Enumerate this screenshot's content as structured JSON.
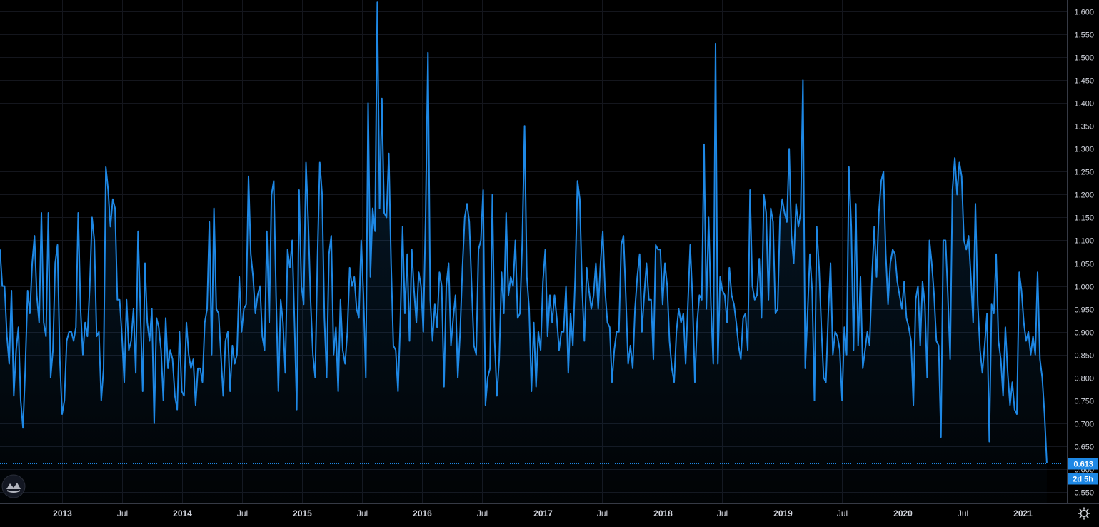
{
  "chart_data": {
    "type": "area",
    "title": "",
    "xlabel": "",
    "ylabel": "",
    "x_ticks": [
      "2013",
      "Jul",
      "2014",
      "Jul",
      "2015",
      "Jul",
      "2016",
      "Jul",
      "2017",
      "Jul",
      "2018",
      "Jul",
      "2019",
      "Jul",
      "2020",
      "Jul",
      "2021"
    ],
    "x_range": [
      "2012-06-25",
      "2021-05-15"
    ],
    "y_ticks": [
      "0.550",
      "0.600",
      "0.650",
      "0.700",
      "0.750",
      "0.800",
      "0.850",
      "0.900",
      "0.950",
      "1.000",
      "1.050",
      "1.100",
      "1.150",
      "1.200",
      "1.250",
      "1.300",
      "1.350",
      "1.400",
      "1.450",
      "1.500",
      "1.550",
      "1.600"
    ],
    "ylim": [
      0.525,
      1.625
    ],
    "series": [
      {
        "color": "#1e88e5",
        "x_start": "2012-06-25",
        "interval": "weekly",
        "values": [
          1.08,
          1.0,
          1.0,
          0.89,
          0.83,
          0.99,
          0.76,
          0.86,
          0.91,
          0.75,
          0.69,
          0.82,
          0.99,
          0.94,
          1.05,
          1.11,
          0.98,
          0.92,
          1.16,
          0.92,
          0.89,
          1.16,
          0.8,
          0.86,
          1.05,
          1.09,
          0.84,
          0.72,
          0.75,
          0.88,
          0.9,
          0.9,
          0.88,
          0.91,
          1.16,
          0.95,
          0.85,
          0.92,
          0.89,
          1.0,
          1.15,
          1.1,
          0.89,
          0.9,
          0.75,
          0.82,
          1.26,
          1.21,
          1.13,
          1.19,
          1.17,
          0.97,
          0.97,
          0.89,
          0.79,
          0.97,
          0.86,
          0.88,
          0.95,
          0.81,
          1.12,
          0.95,
          0.77,
          1.05,
          0.92,
          0.88,
          0.95,
          0.7,
          0.93,
          0.91,
          0.86,
          0.75,
          0.93,
          0.82,
          0.86,
          0.84,
          0.76,
          0.73,
          0.9,
          0.77,
          0.76,
          0.92,
          0.85,
          0.82,
          0.84,
          0.74,
          0.82,
          0.82,
          0.79,
          0.92,
          0.95,
          1.14,
          0.85,
          1.17,
          0.95,
          0.94,
          0.85,
          0.76,
          0.88,
          0.9,
          0.77,
          0.87,
          0.83,
          0.85,
          1.02,
          0.9,
          0.95,
          0.96,
          1.24,
          1.07,
          1.02,
          0.94,
          0.98,
          1.0,
          0.89,
          0.86,
          1.12,
          0.92,
          1.2,
          1.23,
          0.98,
          0.77,
          0.97,
          0.92,
          0.81,
          1.08,
          1.04,
          1.1,
          0.92,
          0.73,
          1.21,
          1.0,
          0.96,
          1.27,
          1.14,
          0.97,
          0.85,
          0.8,
          1.06,
          1.27,
          1.2,
          0.93,
          0.8,
          1.07,
          1.11,
          0.85,
          0.91,
          0.77,
          0.97,
          0.86,
          0.83,
          0.9,
          1.04,
          1.0,
          1.02,
          0.95,
          0.93,
          1.1,
          0.98,
          0.8,
          1.4,
          1.02,
          1.17,
          1.12,
          1.62,
          1.17,
          1.41,
          1.16,
          1.15,
          1.29,
          1.05,
          0.87,
          0.86,
          0.77,
          0.92,
          1.13,
          0.94,
          1.07,
          0.88,
          1.08,
          0.99,
          0.92,
          1.03,
          1.0,
          0.9,
          1.15,
          1.51,
          0.97,
          0.88,
          0.96,
          0.91,
          1.03,
          1.0,
          0.78,
          1.0,
          1.05,
          0.87,
          0.93,
          0.98,
          0.8,
          0.9,
          1.04,
          1.15,
          1.18,
          1.14,
          1.0,
          0.87,
          0.85,
          1.08,
          1.1,
          1.21,
          0.74,
          0.8,
          0.82,
          1.2,
          0.88,
          0.76,
          0.84,
          1.03,
          0.94,
          1.16,
          0.98,
          1.02,
          1.0,
          1.1,
          0.93,
          0.94,
          1.1,
          1.35,
          1.02,
          0.95,
          0.77,
          0.92,
          0.78,
          0.9,
          0.86,
          1.01,
          1.08,
          0.89,
          0.98,
          0.92,
          0.98,
          0.93,
          0.86,
          0.9,
          0.9,
          1.0,
          0.81,
          0.94,
          0.87,
          1.02,
          1.23,
          1.19,
          1.0,
          0.88,
          1.04,
          0.99,
          0.95,
          0.98,
          1.05,
          0.95,
          1.05,
          1.12,
          0.99,
          0.92,
          0.91,
          0.79,
          0.86,
          0.9,
          0.9,
          1.09,
          1.11,
          0.98,
          0.83,
          0.87,
          0.82,
          0.95,
          1.02,
          1.07,
          0.9,
          0.98,
          1.05,
          0.97,
          0.97,
          0.84,
          1.09,
          1.08,
          1.08,
          0.96,
          1.05,
          1.0,
          0.88,
          0.82,
          0.79,
          0.9,
          0.95,
          0.92,
          0.94,
          0.83,
          0.96,
          1.09,
          0.97,
          0.79,
          0.92,
          0.98,
          0.97,
          1.31,
          0.95,
          1.15,
          0.96,
          0.83,
          1.53,
          0.83,
          1.02,
          0.99,
          0.98,
          0.92,
          1.04,
          0.98,
          0.96,
          0.92,
          0.87,
          0.84,
          0.93,
          0.94,
          0.86,
          1.21,
          1.0,
          0.97,
          0.98,
          1.06,
          0.93,
          1.2,
          1.16,
          0.97,
          1.17,
          1.14,
          0.94,
          0.95,
          1.15,
          1.19,
          1.16,
          1.14,
          1.3,
          1.11,
          1.05,
          1.18,
          1.13,
          1.16,
          1.45,
          0.82,
          0.94,
          1.07,
          0.99,
          0.75,
          1.13,
          1.04,
          0.91,
          0.8,
          0.79,
          0.94,
          1.05,
          0.85,
          0.9,
          0.89,
          0.86,
          0.75,
          0.91,
          0.85,
          1.26,
          1.13,
          0.86,
          1.18,
          0.87,
          1.02,
          0.82,
          0.86,
          0.9,
          0.87,
          1.02,
          1.13,
          1.02,
          1.16,
          1.23,
          1.25,
          1.07,
          0.96,
          1.05,
          1.08,
          1.07,
          1.01,
          0.98,
          0.95,
          1.01,
          0.93,
          0.91,
          0.88,
          0.74,
          0.97,
          1.0,
          0.87,
          1.01,
          0.96,
          0.8,
          1.1,
          1.05,
          0.98,
          0.88,
          0.87,
          0.67,
          1.1,
          1.1,
          0.98,
          0.84,
          1.21,
          1.28,
          1.2,
          1.27,
          1.24,
          1.1,
          1.08,
          1.11,
          1.02,
          0.92,
          1.18,
          0.96,
          0.86,
          0.81,
          0.87,
          0.94,
          0.66,
          0.96,
          0.94,
          1.07,
          0.88,
          0.84,
          0.76,
          0.91,
          0.81,
          0.74,
          0.79,
          0.73,
          0.72,
          1.03,
          0.99,
          0.92,
          0.88,
          0.9,
          0.85,
          0.89,
          0.85,
          1.03,
          0.84,
          0.8,
          0.72,
          0.613
        ]
      }
    ],
    "last_value": "0.613",
    "countdown": "2d 5h",
    "grid": true,
    "legend": "none"
  },
  "icons": {
    "brand": "tradingview-logo-icon",
    "settings": "gear-icon"
  }
}
